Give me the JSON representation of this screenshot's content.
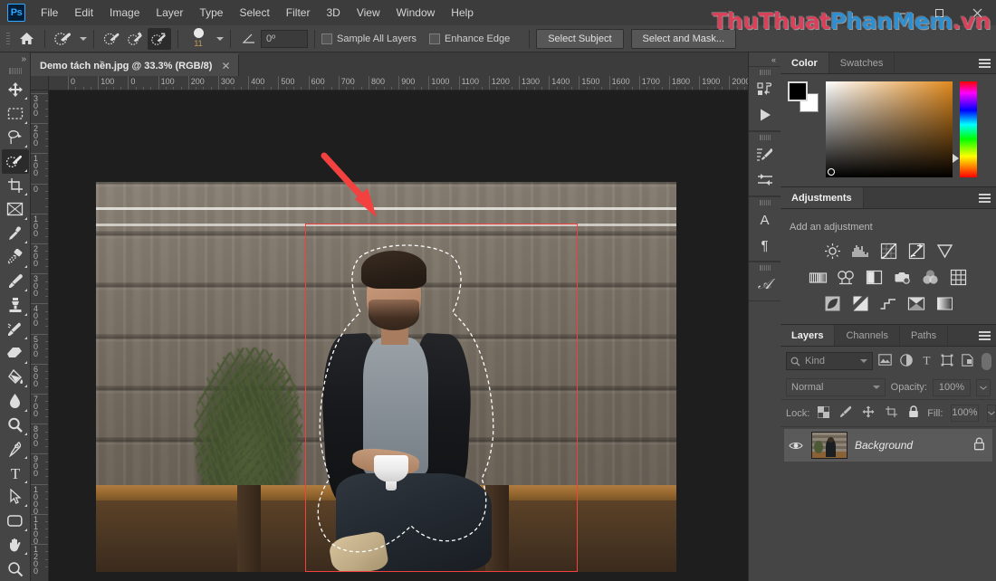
{
  "app": {
    "logo": "Ps",
    "watermark": {
      "part1": "ThuThuat",
      "part2": "PhanMem",
      "part3": ".vn"
    }
  },
  "menubar": {
    "items": [
      "File",
      "Edit",
      "Image",
      "Layer",
      "Type",
      "Select",
      "Filter",
      "3D",
      "View",
      "Window",
      "Help"
    ],
    "window_controls": {
      "minimize": "–",
      "maximize": "❐",
      "close": "✕"
    }
  },
  "options_bar": {
    "home_icon": "home-icon",
    "tool_preset_icon": "quick-selection-tool-icon",
    "mode_new": "new-selection-icon",
    "mode_add": "add-to-selection-icon",
    "mode_subtract": "subtract-from-selection-icon",
    "brush_size": "11",
    "angle_label": "angle-icon",
    "angle_value": "0º",
    "sample_all_layers": "Sample All Layers",
    "enhance_edge": "Enhance Edge",
    "select_subject": "Select Subject",
    "select_and_mask": "Select and Mask...",
    "sample_all_layers_checked": false,
    "enhance_edge_checked": false
  },
  "toolbar": {
    "collapse": "»",
    "tools": [
      {
        "name": "move-tool",
        "glyph": "move"
      },
      {
        "name": "rectangular-marquee-tool",
        "glyph": "marquee"
      },
      {
        "name": "lasso-tool",
        "glyph": "lasso"
      },
      {
        "name": "quick-selection-tool",
        "glyph": "quickselect",
        "active": true
      },
      {
        "name": "crop-tool",
        "glyph": "crop"
      },
      {
        "name": "frame-tool",
        "glyph": "frame"
      },
      {
        "name": "eyedropper-tool",
        "glyph": "eyedropper"
      },
      {
        "name": "spot-healing-brush-tool",
        "glyph": "healing"
      },
      {
        "name": "brush-tool",
        "glyph": "brush"
      },
      {
        "name": "clone-stamp-tool",
        "glyph": "stamp"
      },
      {
        "name": "history-brush-tool",
        "glyph": "historybrush"
      },
      {
        "name": "eraser-tool",
        "glyph": "eraser"
      },
      {
        "name": "gradient-tool",
        "glyph": "paintbucket"
      },
      {
        "name": "blur-tool",
        "glyph": "blur"
      },
      {
        "name": "dodge-tool",
        "glyph": "dodge"
      },
      {
        "name": "pen-tool",
        "glyph": "pen"
      },
      {
        "name": "type-tool",
        "glyph": "type"
      },
      {
        "name": "path-selection-tool",
        "glyph": "pathselect"
      },
      {
        "name": "rectangle-tool",
        "glyph": "rectangle"
      },
      {
        "name": "hand-tool",
        "glyph": "hand"
      },
      {
        "name": "zoom-tool",
        "glyph": "zoom"
      }
    ]
  },
  "document": {
    "tab_title": "Demo tách nền.jpg @ 33.3% (RGB/8)",
    "close_glyph": "✕",
    "zoom_level": "33.3%",
    "color_mode": "RGB/8",
    "ruler_h_labels": [
      "0",
      "100",
      "0",
      "100",
      "200",
      "300",
      "400",
      "500",
      "600",
      "700",
      "800",
      "900",
      "1000",
      "1100",
      "1200",
      "1300",
      "1400",
      "1500",
      "1600",
      "1700",
      "1800",
      "1900",
      "2000"
    ],
    "ruler_v_labels": [
      "300",
      "200",
      "100",
      "0",
      "100",
      "200",
      "300",
      "400",
      "500",
      "600",
      "700",
      "800",
      "900",
      "1000",
      "1100",
      "1200"
    ],
    "annotation": {
      "arrow_color": "#f2413f",
      "rect_color": "#f2413f"
    }
  },
  "dock_strip": {
    "collapse": "«",
    "icons": [
      {
        "name": "history-panel-icon"
      },
      {
        "name": "actions-play-icon"
      },
      {
        "name": "brush-settings-icon"
      },
      {
        "name": "brush-presets-icon"
      },
      {
        "name": "character-panel-icon",
        "glyph": "A"
      },
      {
        "name": "paragraph-panel-icon",
        "glyph": "¶"
      },
      {
        "name": "glyphs-panel-icon",
        "glyph": "𝒜"
      }
    ]
  },
  "color_panel": {
    "tabs": [
      {
        "label": "Color",
        "active": true
      },
      {
        "label": "Swatches",
        "active": false
      }
    ],
    "foreground": "#000000",
    "background": "#ffffff",
    "field_hue": "#e08a1e"
  },
  "adjustments_panel": {
    "tabs": [
      {
        "label": "Adjustments",
        "active": true
      }
    ],
    "hint": "Add an adjustment",
    "rows": [
      [
        {
          "name": "brightness-contrast-icon"
        },
        {
          "name": "levels-icon"
        },
        {
          "name": "curves-icon"
        },
        {
          "name": "exposure-icon"
        },
        {
          "name": "vibrance-icon"
        }
      ],
      [
        {
          "name": "hue-saturation-icon"
        },
        {
          "name": "color-balance-icon"
        },
        {
          "name": "black-white-icon"
        },
        {
          "name": "photo-filter-icon"
        },
        {
          "name": "channel-mixer-icon"
        },
        {
          "name": "color-lookup-icon"
        }
      ],
      [
        {
          "name": "invert-icon"
        },
        {
          "name": "posterize-icon"
        },
        {
          "name": "threshold-icon"
        },
        {
          "name": "selective-color-icon"
        },
        {
          "name": "gradient-map-icon"
        }
      ]
    ]
  },
  "layers_panel": {
    "tabs": [
      {
        "label": "Layers",
        "active": true
      },
      {
        "label": "Channels",
        "active": false
      },
      {
        "label": "Paths",
        "active": false
      }
    ],
    "filter_kind": "Kind",
    "filter_icons": [
      {
        "name": "filter-pixel-layers-icon"
      },
      {
        "name": "filter-adjustment-layers-icon"
      },
      {
        "name": "filter-type-layers-icon"
      },
      {
        "name": "filter-shape-layers-icon"
      },
      {
        "name": "filter-smart-objects-icon"
      }
    ],
    "blend_mode": "Normal",
    "opacity_label": "Opacity:",
    "opacity_value": "100%",
    "lock_label": "Lock:",
    "lock_icons": [
      {
        "name": "lock-transparent-pixels-icon"
      },
      {
        "name": "lock-image-pixels-icon"
      },
      {
        "name": "lock-position-icon"
      },
      {
        "name": "lock-artboard-nesting-icon"
      },
      {
        "name": "lock-all-icon"
      }
    ],
    "fill_label": "Fill:",
    "fill_value": "100%",
    "layers": [
      {
        "name": "Background",
        "visible": true,
        "locked": true
      }
    ]
  }
}
